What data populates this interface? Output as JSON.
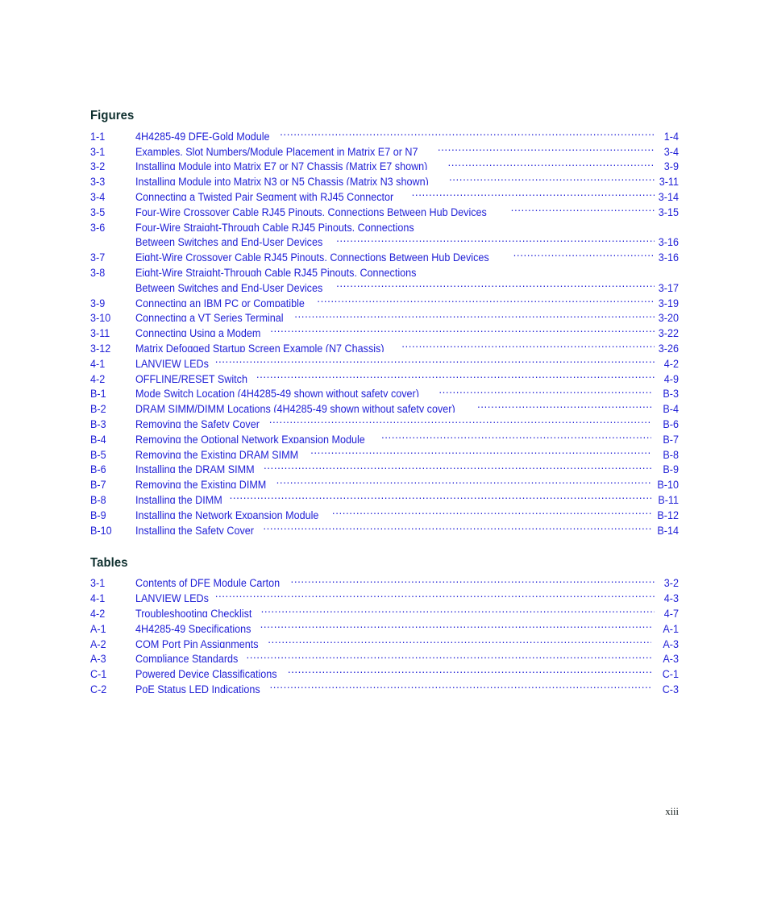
{
  "page": {
    "footer_page_number": "xiii",
    "accent_blue": "#1f1fd6",
    "heading_color": "#0e2f2e"
  },
  "figures": {
    "heading": "Figures",
    "entries": [
      {
        "number": "1-1",
        "title": "4H4285-49 DFE-Gold Module",
        "page": "1-4",
        "gap_before_page": false
      },
      {
        "number": "3-1",
        "title": "Examples, Slot Numbers/Module Placement in Matrix E7 or N7",
        "page": "3-4",
        "gap_before_page": false
      },
      {
        "number": "3-2",
        "title": "Installing Module into Matrix E7 or N7 Chassis (Matrix E7 shown)",
        "page": "3-9",
        "gap_before_page": false
      },
      {
        "number": "3-3",
        "title": "Installing Module into Matrix N3 or N5 Chassis (Matrix N3 shown)",
        "page": "3-11",
        "gap_before_page": false
      },
      {
        "number": "3-4",
        "title": "Connecting a Twisted Pair Segment with RJ45 Connector",
        "page": "3-14",
        "gap_before_page": false
      },
      {
        "number": "3-5",
        "title": "Four-Wire Crossover Cable RJ45 Pinouts, Connections Between Hub Devices",
        "page": "3-15",
        "gap_before_page": false
      },
      {
        "number": "3-6",
        "title": "Four-Wire Straight-Through Cable RJ45 Pinouts, Connections",
        "title2": "Between Switches and End-User Devices",
        "page": "3-16",
        "gap_before_page": false
      },
      {
        "number": "3-7",
        "title": "Eight-Wire Crossover Cable RJ45 Pinouts, Connections Between Hub Devices",
        "page": "3-16",
        "gap_before_page": false
      },
      {
        "number": "3-8",
        "title": "Eight-Wire Straight-Through Cable RJ45 Pinouts, Connections",
        "title2": "Between Switches and End-User Devices",
        "page": "3-17",
        "gap_before_page": false
      },
      {
        "number": "3-9",
        "title": "Connecting an IBM PC or Compatible",
        "page": "3-19",
        "gap_before_page": false
      },
      {
        "number": "3-10",
        "title": "Connecting a VT Series Terminal",
        "page": "3-20",
        "gap_before_page": false
      },
      {
        "number": "3-11",
        "title": "Connecting Using a Modem",
        "page": "3-22",
        "gap_before_page": false
      },
      {
        "number": "3-12",
        "title": "Matrix Defogged Startup Screen Example (N7 Chassis)",
        "page": "3-26",
        "gap_before_page": false
      },
      {
        "number": "4-1",
        "title": "LANVIEW LEDs",
        "page": "4-2",
        "gap_before_page": false
      },
      {
        "number": "4-2",
        "title": "OFFLINE/RESET Switch",
        "page": "4-9",
        "gap_before_page": false
      },
      {
        "number": "B-1",
        "title": "Mode Switch Location (4H4285-49 shown without safety cover)",
        "page": "B-3",
        "gap_before_page": true
      },
      {
        "number": "B-2",
        "title": "DRAM SIMM/DIMM Locations (4H4285-49 shown without safety cover)",
        "page": "B-4",
        "gap_before_page": true
      },
      {
        "number": "B-3",
        "title": "Removing the Safety Cover",
        "page": "B-6",
        "gap_before_page": true
      },
      {
        "number": "B-4",
        "title": "Removing the Optional Network Expansion Module",
        "page": "B-7",
        "gap_before_page": true
      },
      {
        "number": "B-5",
        "title": "Removing the Existing DRAM SIMM",
        "page": "B-8",
        "gap_before_page": true
      },
      {
        "number": "B-6",
        "title": "Installing the DRAM SIMM",
        "page": "B-9",
        "gap_before_page": true
      },
      {
        "number": "B-7",
        "title": "Removing the Existing DIMM",
        "page": "B-10",
        "gap_before_page": true
      },
      {
        "number": "B-8",
        "title": "Installing the DIMM",
        "page": "B-11",
        "gap_before_page": true
      },
      {
        "number": "B-9",
        "title": "Installing the Network Expansion Module",
        "page": "B-12",
        "gap_before_page": true
      },
      {
        "number": "B-10",
        "title": "Installing the Safety Cover",
        "page": "B-14",
        "gap_before_page": true
      }
    ]
  },
  "tables": {
    "heading": "Tables",
    "entries": [
      {
        "number": "3-1",
        "title": "Contents of DFE Module Carton",
        "page": "3-2",
        "gap_before_page": false
      },
      {
        "number": "4-1",
        "title": "LANVIEW LEDs",
        "page": "4-3",
        "gap_before_page": false
      },
      {
        "number": "4-2",
        "title": "Troubleshooting Checklist",
        "page": "4-7",
        "gap_before_page": false
      },
      {
        "number": "A-1",
        "title": "4H4285-49 Specifications",
        "page": "A-1",
        "gap_before_page": true
      },
      {
        "number": "A-2",
        "title": "COM Port Pin Assignments",
        "page": "A-3",
        "gap_before_page": true
      },
      {
        "number": "A-3",
        "title": "Compliance Standards",
        "page": "A-3",
        "gap_before_page": true
      },
      {
        "number": "C-1",
        "title": "Powered Device Classifications",
        "page": "C-1",
        "gap_before_page": true
      },
      {
        "number": "C-2",
        "title": "PoE Status LED Indications",
        "page": "C-3",
        "gap_before_page": true
      }
    ]
  }
}
